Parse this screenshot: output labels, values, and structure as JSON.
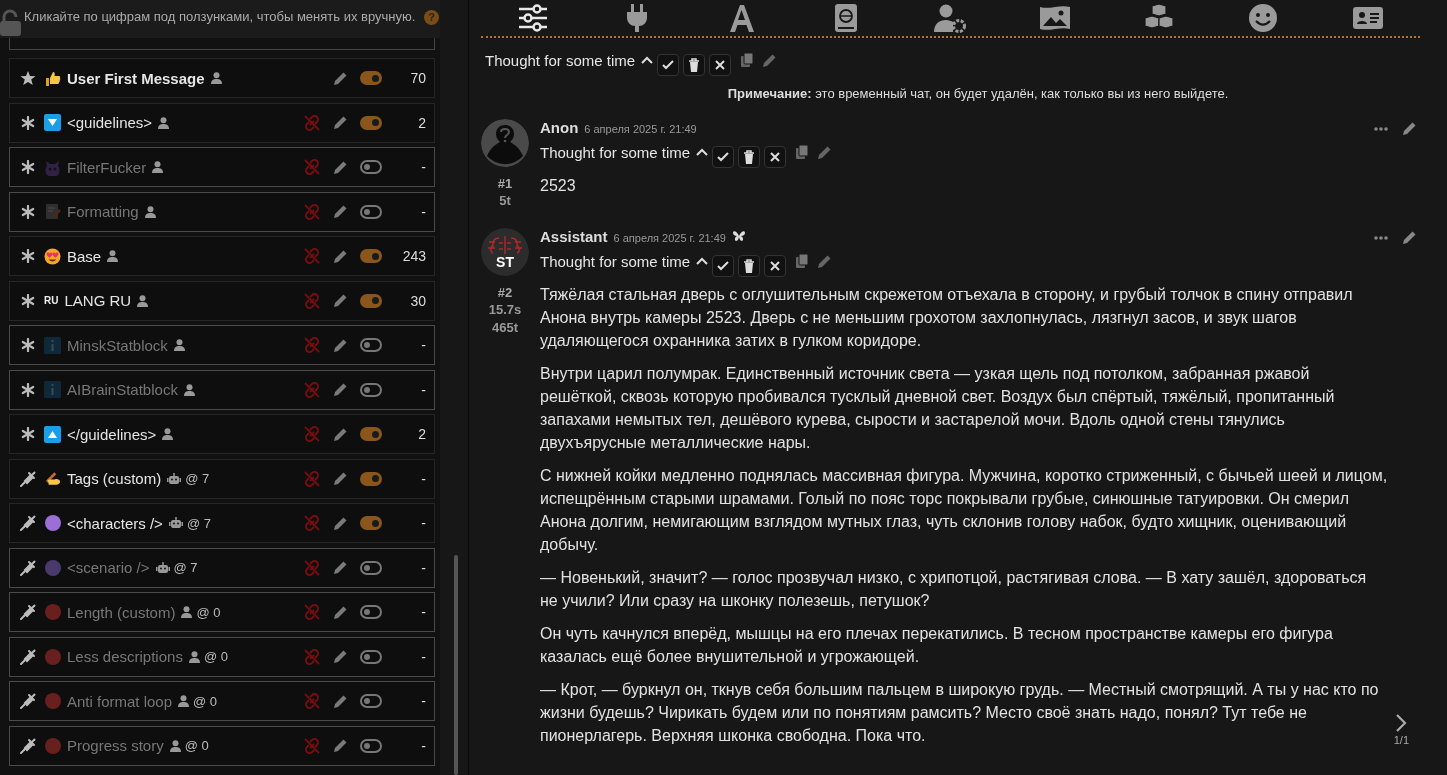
{
  "hint_bar": {
    "text": "Кликайте по цифрам под ползунками, чтобы менять их вручную.",
    "help_label": "?"
  },
  "entries": [
    {
      "marker": {
        "kind": "star"
      },
      "emoji": {
        "kind": "thumb"
      },
      "name": "User First Message",
      "bold": true,
      "owner": {
        "kind": "user"
      },
      "link_off": false,
      "enabled": true,
      "value": "70"
    },
    {
      "marker": {
        "kind": "asterisk"
      },
      "emoji": {
        "kind": "down"
      },
      "name": "<guidelines>",
      "bold": false,
      "owner": {
        "kind": "user"
      },
      "link_off": true,
      "enabled": true,
      "value": "2"
    },
    {
      "marker": {
        "kind": "asterisk"
      },
      "emoji": {
        "kind": "devil"
      },
      "name": "FilterFucker",
      "bold": false,
      "owner": {
        "kind": "user"
      },
      "link_off": true,
      "enabled": false,
      "value": "-"
    },
    {
      "marker": {
        "kind": "asterisk"
      },
      "emoji": {
        "kind": "memo"
      },
      "name": "Formatting",
      "bold": false,
      "owner": {
        "kind": "user"
      },
      "link_off": true,
      "enabled": false,
      "value": "-"
    },
    {
      "marker": {
        "kind": "asterisk"
      },
      "emoji": {
        "kind": "hearteyes"
      },
      "name": "Base",
      "bold": false,
      "owner": {
        "kind": "user"
      },
      "link_off": true,
      "enabled": true,
      "value": "243"
    },
    {
      "marker": {
        "kind": "asterisk"
      },
      "emoji": {
        "kind": "letters",
        "text": "RU"
      },
      "name": "LANG RU",
      "bold": false,
      "owner": {
        "kind": "user"
      },
      "link_off": true,
      "enabled": true,
      "value": "30"
    },
    {
      "marker": {
        "kind": "asterisk"
      },
      "emoji": {
        "kind": "info"
      },
      "name": "MinskStatblock",
      "bold": false,
      "owner": {
        "kind": "user"
      },
      "link_off": true,
      "enabled": false,
      "value": "-"
    },
    {
      "marker": {
        "kind": "asterisk"
      },
      "emoji": {
        "kind": "info"
      },
      "name": "AIBrainStatblock",
      "bold": false,
      "owner": {
        "kind": "user"
      },
      "link_off": true,
      "enabled": false,
      "value": "-"
    },
    {
      "marker": {
        "kind": "asterisk"
      },
      "emoji": {
        "kind": "up"
      },
      "name": "</guidelines>",
      "bold": false,
      "owner": {
        "kind": "user"
      },
      "link_off": true,
      "enabled": true,
      "value": "2"
    },
    {
      "marker": {
        "kind": "syringe"
      },
      "emoji": {
        "kind": "write"
      },
      "name": "Tags (custom)",
      "bold": false,
      "owner": {
        "kind": "bot"
      },
      "depth": "@ 7",
      "link_off": true,
      "enabled": true,
      "value": "-"
    },
    {
      "marker": {
        "kind": "syringe"
      },
      "emoji": {
        "kind": "dot"
      },
      "color": "#9b6fd6",
      "name": "<characters />",
      "bold": false,
      "owner": {
        "kind": "bot"
      },
      "depth": "@ 7",
      "link_off": true,
      "enabled": true,
      "value": "-"
    },
    {
      "marker": {
        "kind": "syringe"
      },
      "emoji": {
        "kind": "dot"
      },
      "color": "#4a3a6c",
      "name": "<scenario />",
      "bold": false,
      "owner": {
        "kind": "bot"
      },
      "depth": "@ 7",
      "link_off": true,
      "enabled": false,
      "value": "-"
    },
    {
      "marker": {
        "kind": "syringe"
      },
      "emoji": {
        "kind": "dot"
      },
      "color": "#6a1f1f",
      "name": "Length (custom)",
      "bold": false,
      "owner": {
        "kind": "user"
      },
      "depth": "@ 0",
      "link_off": true,
      "enabled": false,
      "value": "-"
    },
    {
      "marker": {
        "kind": "syringe"
      },
      "emoji": {
        "kind": "dot"
      },
      "color": "#6a1f1f",
      "name": "Less descriptions",
      "bold": false,
      "owner": {
        "kind": "user"
      },
      "depth": "@ 0",
      "link_off": true,
      "enabled": false,
      "value": "-"
    },
    {
      "marker": {
        "kind": "syringe"
      },
      "emoji": {
        "kind": "dot"
      },
      "color": "#6a1f1f",
      "name": "Anti format loop",
      "bold": false,
      "owner": {
        "kind": "user"
      },
      "depth": "@ 0",
      "link_off": true,
      "enabled": false,
      "value": "-"
    },
    {
      "marker": {
        "kind": "syringe"
      },
      "emoji": {
        "kind": "dot"
      },
      "color": "#6a1f1f",
      "name": "Progress story",
      "bold": false,
      "owner": {
        "kind": "user"
      },
      "depth": "@ 0",
      "link_off": true,
      "enabled": false,
      "value": "-"
    }
  ],
  "nav_tabs": [
    {
      "kind": "sliders",
      "selected": true
    },
    {
      "kind": "plug",
      "selected": false
    },
    {
      "kind": "font",
      "selected": false
    },
    {
      "kind": "globe-book",
      "selected": false
    },
    {
      "kind": "user-gear",
      "selected": false
    },
    {
      "kind": "image",
      "selected": false
    },
    {
      "kind": "cubes",
      "selected": false
    },
    {
      "kind": "smiley",
      "selected": false
    },
    {
      "kind": "id-card",
      "selected": false
    }
  ],
  "chat": [
    {
      "kind": "partial",
      "thought": "Thought for some time"
    },
    {
      "kind": "note",
      "text": "**Примечание:** это временный чат, он будет удалён, как только вы из него выйдете."
    },
    {
      "kind": "message",
      "avatar": {
        "kind": "silhouette"
      },
      "name": "Anon",
      "date": "6 апреля 2025 г. 21:49",
      "model_icon": false,
      "number": "#1",
      "stats": [
        "5t"
      ],
      "thought": "Thought for some time",
      "paragraphs": [
        "2523"
      ]
    },
    {
      "kind": "message",
      "avatar": {
        "kind": "logo",
        "label": "ST"
      },
      "name": "Assistant",
      "date": "6 апреля 2025 г. 21:49",
      "model_icon": true,
      "number": "#2",
      "stats": [
        "15.7s",
        "465t"
      ],
      "thought": "Thought for some time",
      "paragraphs": [
        "Тяжёлая стальная дверь с оглушительным скрежетом отъехала в сторону, и грубый толчок в спину отправил Анона внутрь камеры 2523. Дверь с не меньшим грохотом захлопнулась, лязгнул засов, и звук шагов удаляющегося охранника затих в гулком коридоре.",
        "Внутри царил полумрак. Единственный источник света — узкая щель под потолком, забранная ржавой решёткой, сквозь которую пробивался тусклый дневной свет. Воздух был спёртый, тяжёлый, пропитанный запахами немытых тел, дешёвого курева, сырости и застарелой мочи. Вдоль одной стены тянулись двухъярусные металлические нары.",
        "С нижней койки медленно поднялась массивная фигура. Мужчина, коротко стриженный, с бычьей шеей и лицом, испещрённым старыми шрамами. Голый по пояс торс покрывали грубые, синюшные татуировки. Он смерил Анона долгим, немигающим взглядом мутных глаз, чуть склонив голову набок, будто хищник, оценивающий добычу.",
        "— Новенький, значит? — голос прозвучал низко, с хрипотцой, растягивая слова. — В хату зашёл, здороваться не учили? Или сразу на шконку полезешь, петушок?",
        "Он чуть качнулся вперёд, мышцы на его плечах перекатились. В тесном пространстве камеры его фигура казалась ещё более внушительной и угрожающей.",
        "— Крот, — буркнул он, ткнув себя большим пальцем в широкую грудь. — Местный смотрящий. А ты у нас кто по жизни будешь? Чирикать будем или по понятиям рамсить? Место своё знать надо, понял? Тут тебе не пионерлагерь. Верхняя шконка свободна. Пока что."
      ]
    }
  ],
  "swipe": {
    "counter": "1/1"
  }
}
